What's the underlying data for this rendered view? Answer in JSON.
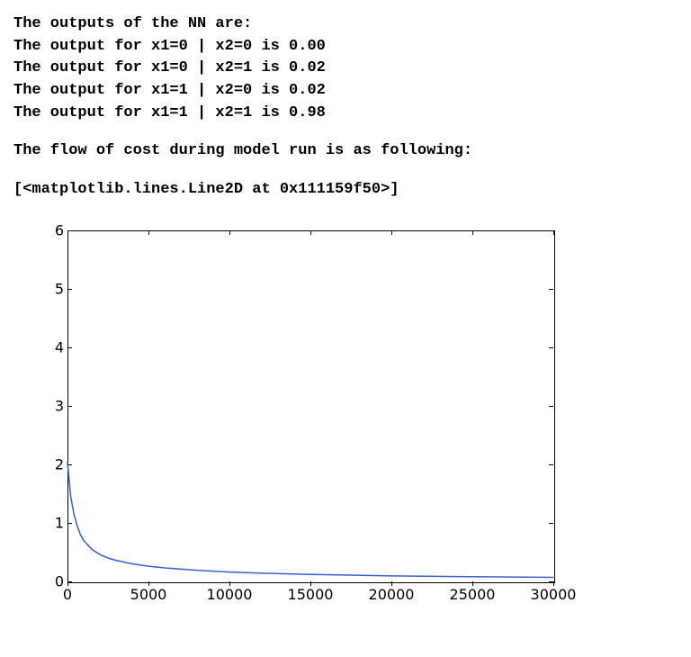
{
  "lines": {
    "header": "The outputs of the NN are:",
    "r1": "The output for x1=0 | x2=0 is 0.00",
    "r2": "The output for x1=0 | x2=1 is 0.02",
    "r3": "The output for x1=1 | x2=0 is 0.02",
    "r4": "The output for x1=1 | x2=1 is 0.98",
    "flow": "The flow of cost during model run is as following:",
    "repr": "[<matplotlib.lines.Line2D at 0x111159f50>]"
  },
  "chart_data": {
    "type": "line",
    "title": "",
    "xlabel": "",
    "ylabel": "",
    "xlim": [
      0,
      30000
    ],
    "ylim": [
      0,
      6
    ],
    "xticks": [
      0,
      5000,
      10000,
      15000,
      20000,
      25000,
      30000
    ],
    "yticks": [
      0,
      1,
      2,
      3,
      4,
      5,
      6
    ],
    "series": [
      {
        "name": "cost",
        "color": "#3b5fd6",
        "x": [
          0,
          200,
          400,
          600,
          800,
          1000,
          1500,
          2000,
          2500,
          3000,
          4000,
          5000,
          6000,
          8000,
          10000,
          12000,
          15000,
          20000,
          25000,
          30000
        ],
        "y": [
          2.05,
          1.45,
          1.15,
          0.95,
          0.8,
          0.7,
          0.55,
          0.46,
          0.4,
          0.36,
          0.3,
          0.26,
          0.23,
          0.19,
          0.16,
          0.14,
          0.12,
          0.095,
          0.08,
          0.07
        ]
      }
    ]
  }
}
